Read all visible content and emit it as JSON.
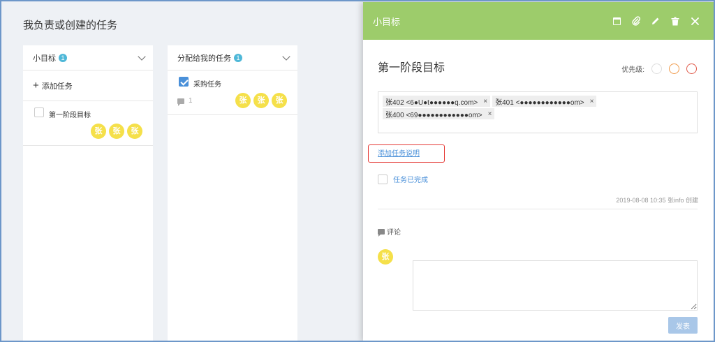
{
  "page": {
    "title": "我负责或创建的任务"
  },
  "columns": [
    {
      "title": "小目标",
      "badge": "1",
      "add_label": "添加任务",
      "tasks": [
        {
          "title": "第一阶段目标",
          "checked": false,
          "avatars": [
            "张",
            "张",
            "张"
          ]
        }
      ]
    },
    {
      "title": "分配给我的任务",
      "badge": "1",
      "tasks": [
        {
          "title": "采购任务",
          "checked": true,
          "comment_count": "1",
          "avatars": [
            "张",
            "张",
            "张"
          ]
        }
      ]
    }
  ],
  "panel": {
    "header_title": "小目标",
    "header_icons": [
      "calendar-icon",
      "paperclip-icon",
      "pencil-icon",
      "trash-icon",
      "close-icon"
    ],
    "goal_title": "第一阶段目标",
    "priority_label": "优先级:",
    "priority_colors": [
      "#dddddd",
      "#f09a4a",
      "#e05a4a"
    ],
    "members": [
      {
        "label": "张402 <6●U●t●●●●●●q.com>",
        "remove": "×"
      },
      {
        "label": "张401 <●●●●●●●●●●●●om>",
        "remove": "×"
      },
      {
        "label": "张400 <69●●●●●●●●●●●●om>",
        "remove": "×"
      }
    ],
    "add_description_label": "添加任务说明",
    "completed_label": "任务已完成",
    "meta": "2019-08-08 10:35 张info 创建",
    "comment_section_label": "评论",
    "current_user_avatar": "张",
    "comment_placeholder": "",
    "send_label": "发表"
  },
  "colors": {
    "panel_header": "#9dcc6b",
    "avatar": "#f5e04a",
    "link": "#4a90d9",
    "highlight": "#e53935",
    "badge": "#4fb8d8"
  }
}
